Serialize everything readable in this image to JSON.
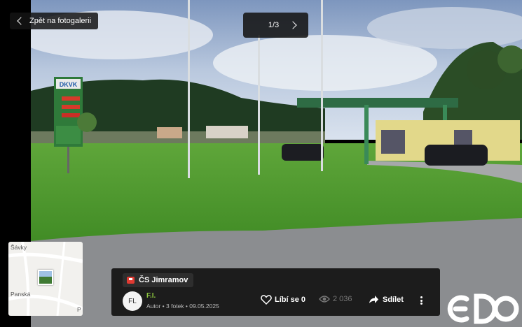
{
  "nav": {
    "back_label": "Zpět na fotogalerii"
  },
  "pager": {
    "text": "1/3"
  },
  "photo": {
    "sign_brand": "DKVK"
  },
  "minimap": {
    "label_top": "Šávky",
    "label_bottom": "Panská",
    "label_edge": "P"
  },
  "info": {
    "place_name": "ČS Jimramov",
    "avatar_initials": "FL",
    "author_name": "F.I.",
    "meta": "Autor • 3 fotek • 09.05.2025",
    "like_label": "Líbí se 0",
    "views": "2 036",
    "share_label": "Sdílet"
  },
  "icons": [
    "chevron-left-icon",
    "chevron-right-icon",
    "place-pin-icon",
    "heart-icon",
    "eye-icon",
    "share-icon",
    "more-vertical-icon"
  ],
  "colors": {
    "author": "#8cc63f",
    "accent_pin": "#e03a32",
    "panel": "#121212"
  }
}
